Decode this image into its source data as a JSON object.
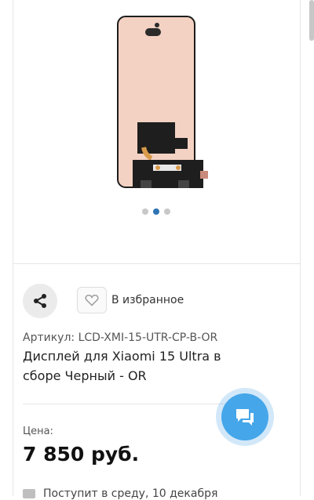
{
  "gallery": {
    "slides": 3,
    "active_slide": 2,
    "image_icon": "phone-display-assembly"
  },
  "actions": {
    "share_icon": "share-icon",
    "favorite_icon": "heart-icon",
    "favorite_label": "В избранное"
  },
  "product": {
    "article": "Артикул: LCD-XMI-15-UTR-CP-B-OR",
    "title": "Дисплей для Xiaomi 15 Ultra в сборе Черный - OR",
    "price_label": "Цена:",
    "price": "7 850 руб.",
    "stock_text": "Поступит в среду, 10 декабря"
  },
  "chat": {
    "icon": "chat-bubbles-icon"
  },
  "colors": {
    "accent": "#2f74b5",
    "chat_fab": "#45a6ea",
    "panel_bg": "#f6d8c8"
  }
}
